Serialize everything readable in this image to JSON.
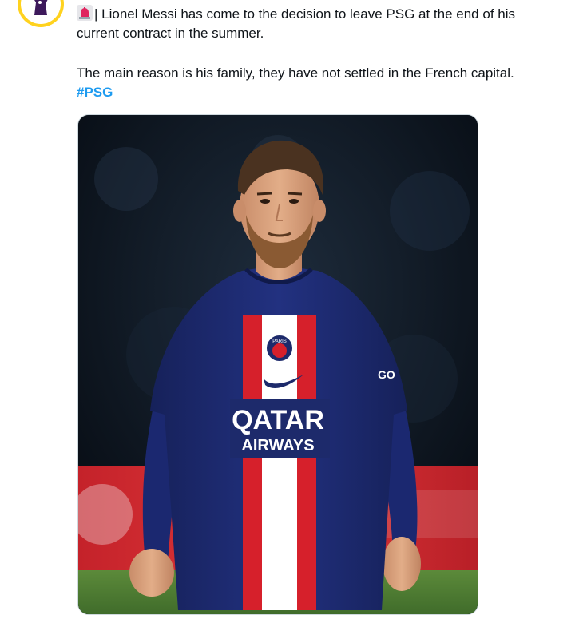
{
  "tweet": {
    "line1": "| Lionel Messi has come to the decision to leave PSG at the end of his",
    "line2": "current contract in the summer.",
    "line3": "The main reason is his family, they have not settled in the French capital.",
    "hashtag": "#PSG"
  },
  "avatar": {
    "icon": "premier-league-lion-icon",
    "ring_color": "#ffd21e"
  },
  "siren": {
    "icon": "police-siren-icon",
    "color": "#e0245e"
  },
  "media": {
    "jersey": {
      "brand_line1": "QATAR",
      "brand_line2": "AIRWAYS",
      "crest_text": "PARIS",
      "sleeve_text": "GO",
      "colors": {
        "navy": "#1d2a6b",
        "stripe_red": "#d6202b",
        "stripe_white": "#ffffff"
      }
    }
  },
  "colors": {
    "hashtag": "#1d9bf0",
    "text": "#0f1419"
  }
}
